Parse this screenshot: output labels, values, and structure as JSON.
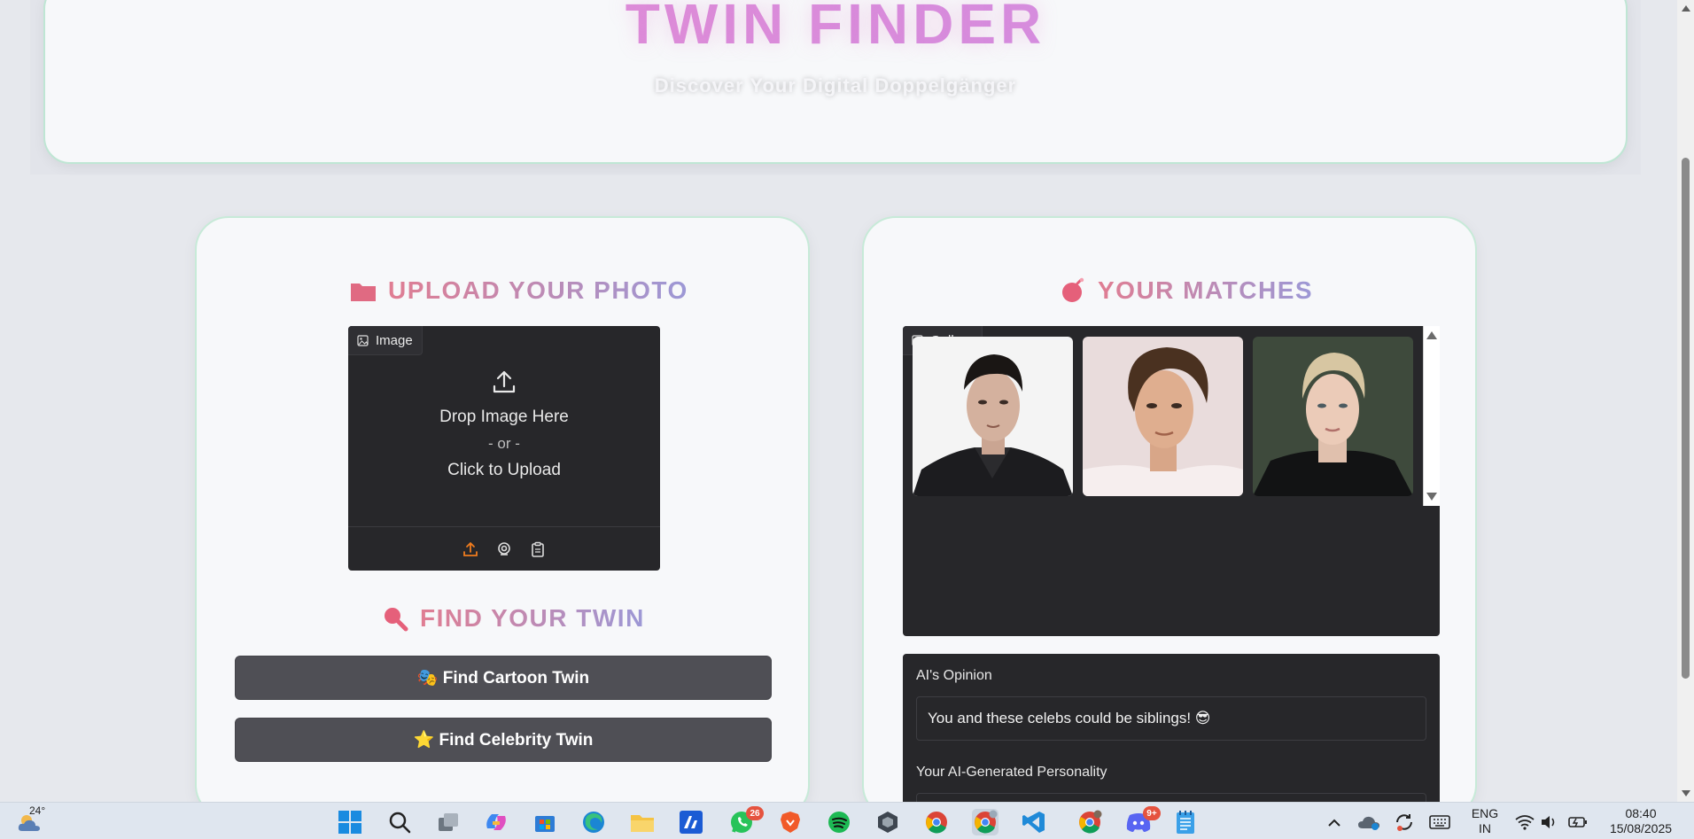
{
  "header": {
    "title": "TWIN FINDER",
    "subtitle": "Discover Your Digital Doppelgänger"
  },
  "upload_panel": {
    "heading": "UPLOAD YOUR PHOTO",
    "image_chip": "Image",
    "drop_text": "Drop Image Here",
    "or_text": "- or -",
    "click_text": "Click to Upload",
    "toolbar_icons": [
      "upload-icon",
      "webcam-icon",
      "clipboard-icon"
    ]
  },
  "find_section": {
    "heading": "FIND YOUR TWIN",
    "cartoon_button": "🎭 Find Cartoon Twin",
    "celebrity_button": "⭐ Find Celebrity Twin"
  },
  "matches_panel": {
    "heading": "YOUR MATCHES",
    "gallery_chip": "Gallery",
    "thumbnails": [
      "match-1",
      "match-2",
      "match-3"
    ],
    "opinion_label": "AI's Opinion",
    "opinion_value": "You and these celebs could be siblings! 😎",
    "personality_label": "Your AI-Generated Personality"
  },
  "taskbar": {
    "weather_temp": "24°",
    "whatsapp_badge": "26",
    "discord_badge": "9+",
    "language_top": "ENG",
    "language_bottom": "IN",
    "time": "08:40",
    "date": "15/08/2025"
  },
  "colors": {
    "accent_pink": "#e08ed8",
    "upload_orange": "#f07c1e",
    "button_bg": "#4f4f55"
  }
}
